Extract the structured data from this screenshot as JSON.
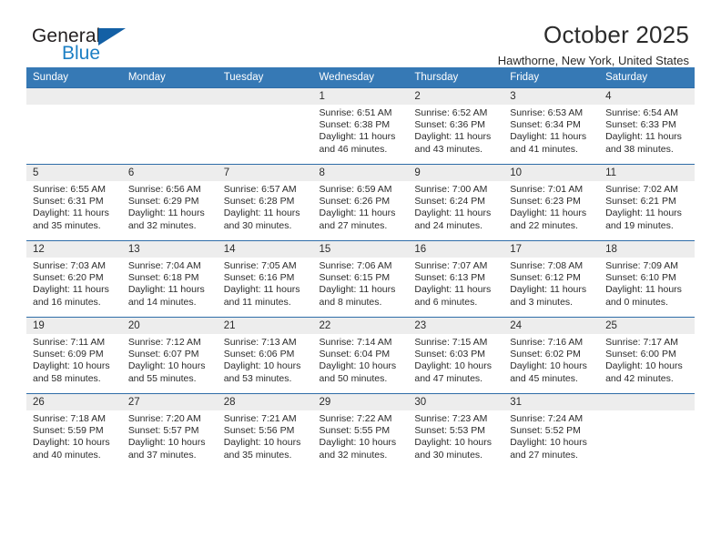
{
  "brand": {
    "word_one": "General",
    "word_two": "Blue",
    "logo_icon": "triangle-logo-icon",
    "accent_color": "#1360a5",
    "blue_text_color": "#1c7fc4"
  },
  "header": {
    "title": "October 2025",
    "subtitle": "Hawthorne, New York, United States"
  },
  "calendar": {
    "header_bg": "#3679b5",
    "daynum_bg": "#ededed",
    "grid_line": "#2f6da8",
    "weekday_headers": [
      "Sunday",
      "Monday",
      "Tuesday",
      "Wednesday",
      "Thursday",
      "Friday",
      "Saturday"
    ],
    "weeks": [
      [
        {
          "day": "",
          "sunrise": "",
          "sunset": "",
          "daylight": "",
          "empty": true
        },
        {
          "day": "",
          "sunrise": "",
          "sunset": "",
          "daylight": "",
          "empty": true
        },
        {
          "day": "",
          "sunrise": "",
          "sunset": "",
          "daylight": "",
          "empty": true
        },
        {
          "day": "1",
          "sunrise": "Sunrise: 6:51 AM",
          "sunset": "Sunset: 6:38 PM",
          "daylight": "Daylight: 11 hours and 46 minutes.",
          "empty": false
        },
        {
          "day": "2",
          "sunrise": "Sunrise: 6:52 AM",
          "sunset": "Sunset: 6:36 PM",
          "daylight": "Daylight: 11 hours and 43 minutes.",
          "empty": false
        },
        {
          "day": "3",
          "sunrise": "Sunrise: 6:53 AM",
          "sunset": "Sunset: 6:34 PM",
          "daylight": "Daylight: 11 hours and 41 minutes.",
          "empty": false
        },
        {
          "day": "4",
          "sunrise": "Sunrise: 6:54 AM",
          "sunset": "Sunset: 6:33 PM",
          "daylight": "Daylight: 11 hours and 38 minutes.",
          "empty": false
        }
      ],
      [
        {
          "day": "5",
          "sunrise": "Sunrise: 6:55 AM",
          "sunset": "Sunset: 6:31 PM",
          "daylight": "Daylight: 11 hours and 35 minutes.",
          "empty": false
        },
        {
          "day": "6",
          "sunrise": "Sunrise: 6:56 AM",
          "sunset": "Sunset: 6:29 PM",
          "daylight": "Daylight: 11 hours and 32 minutes.",
          "empty": false
        },
        {
          "day": "7",
          "sunrise": "Sunrise: 6:57 AM",
          "sunset": "Sunset: 6:28 PM",
          "daylight": "Daylight: 11 hours and 30 minutes.",
          "empty": false
        },
        {
          "day": "8",
          "sunrise": "Sunrise: 6:59 AM",
          "sunset": "Sunset: 6:26 PM",
          "daylight": "Daylight: 11 hours and 27 minutes.",
          "empty": false
        },
        {
          "day": "9",
          "sunrise": "Sunrise: 7:00 AM",
          "sunset": "Sunset: 6:24 PM",
          "daylight": "Daylight: 11 hours and 24 minutes.",
          "empty": false
        },
        {
          "day": "10",
          "sunrise": "Sunrise: 7:01 AM",
          "sunset": "Sunset: 6:23 PM",
          "daylight": "Daylight: 11 hours and 22 minutes.",
          "empty": false
        },
        {
          "day": "11",
          "sunrise": "Sunrise: 7:02 AM",
          "sunset": "Sunset: 6:21 PM",
          "daylight": "Daylight: 11 hours and 19 minutes.",
          "empty": false
        }
      ],
      [
        {
          "day": "12",
          "sunrise": "Sunrise: 7:03 AM",
          "sunset": "Sunset: 6:20 PM",
          "daylight": "Daylight: 11 hours and 16 minutes.",
          "empty": false
        },
        {
          "day": "13",
          "sunrise": "Sunrise: 7:04 AM",
          "sunset": "Sunset: 6:18 PM",
          "daylight": "Daylight: 11 hours and 14 minutes.",
          "empty": false
        },
        {
          "day": "14",
          "sunrise": "Sunrise: 7:05 AM",
          "sunset": "Sunset: 6:16 PM",
          "daylight": "Daylight: 11 hours and 11 minutes.",
          "empty": false
        },
        {
          "day": "15",
          "sunrise": "Sunrise: 7:06 AM",
          "sunset": "Sunset: 6:15 PM",
          "daylight": "Daylight: 11 hours and 8 minutes.",
          "empty": false
        },
        {
          "day": "16",
          "sunrise": "Sunrise: 7:07 AM",
          "sunset": "Sunset: 6:13 PM",
          "daylight": "Daylight: 11 hours and 6 minutes.",
          "empty": false
        },
        {
          "day": "17",
          "sunrise": "Sunrise: 7:08 AM",
          "sunset": "Sunset: 6:12 PM",
          "daylight": "Daylight: 11 hours and 3 minutes.",
          "empty": false
        },
        {
          "day": "18",
          "sunrise": "Sunrise: 7:09 AM",
          "sunset": "Sunset: 6:10 PM",
          "daylight": "Daylight: 11 hours and 0 minutes.",
          "empty": false
        }
      ],
      [
        {
          "day": "19",
          "sunrise": "Sunrise: 7:11 AM",
          "sunset": "Sunset: 6:09 PM",
          "daylight": "Daylight: 10 hours and 58 minutes.",
          "empty": false
        },
        {
          "day": "20",
          "sunrise": "Sunrise: 7:12 AM",
          "sunset": "Sunset: 6:07 PM",
          "daylight": "Daylight: 10 hours and 55 minutes.",
          "empty": false
        },
        {
          "day": "21",
          "sunrise": "Sunrise: 7:13 AM",
          "sunset": "Sunset: 6:06 PM",
          "daylight": "Daylight: 10 hours and 53 minutes.",
          "empty": false
        },
        {
          "day": "22",
          "sunrise": "Sunrise: 7:14 AM",
          "sunset": "Sunset: 6:04 PM",
          "daylight": "Daylight: 10 hours and 50 minutes.",
          "empty": false
        },
        {
          "day": "23",
          "sunrise": "Sunrise: 7:15 AM",
          "sunset": "Sunset: 6:03 PM",
          "daylight": "Daylight: 10 hours and 47 minutes.",
          "empty": false
        },
        {
          "day": "24",
          "sunrise": "Sunrise: 7:16 AM",
          "sunset": "Sunset: 6:02 PM",
          "daylight": "Daylight: 10 hours and 45 minutes.",
          "empty": false
        },
        {
          "day": "25",
          "sunrise": "Sunrise: 7:17 AM",
          "sunset": "Sunset: 6:00 PM",
          "daylight": "Daylight: 10 hours and 42 minutes.",
          "empty": false
        }
      ],
      [
        {
          "day": "26",
          "sunrise": "Sunrise: 7:18 AM",
          "sunset": "Sunset: 5:59 PM",
          "daylight": "Daylight: 10 hours and 40 minutes.",
          "empty": false
        },
        {
          "day": "27",
          "sunrise": "Sunrise: 7:20 AM",
          "sunset": "Sunset: 5:57 PM",
          "daylight": "Daylight: 10 hours and 37 minutes.",
          "empty": false
        },
        {
          "day": "28",
          "sunrise": "Sunrise: 7:21 AM",
          "sunset": "Sunset: 5:56 PM",
          "daylight": "Daylight: 10 hours and 35 minutes.",
          "empty": false
        },
        {
          "day": "29",
          "sunrise": "Sunrise: 7:22 AM",
          "sunset": "Sunset: 5:55 PM",
          "daylight": "Daylight: 10 hours and 32 minutes.",
          "empty": false
        },
        {
          "day": "30",
          "sunrise": "Sunrise: 7:23 AM",
          "sunset": "Sunset: 5:53 PM",
          "daylight": "Daylight: 10 hours and 30 minutes.",
          "empty": false
        },
        {
          "day": "31",
          "sunrise": "Sunrise: 7:24 AM",
          "sunset": "Sunset: 5:52 PM",
          "daylight": "Daylight: 10 hours and 27 minutes.",
          "empty": false
        },
        {
          "day": "",
          "sunrise": "",
          "sunset": "",
          "daylight": "",
          "empty": true
        }
      ]
    ]
  }
}
